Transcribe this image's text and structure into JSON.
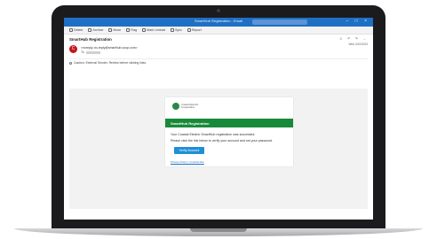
{
  "window": {
    "title": "SmartHub Registration - Email"
  },
  "toolbar": [
    {
      "label": "Delete"
    },
    {
      "label": "Archive"
    },
    {
      "label": "Move"
    },
    {
      "label": "Flag"
    },
    {
      "label": "Mark Unread"
    },
    {
      "label": "Sync"
    },
    {
      "label": "Report"
    }
  ],
  "email": {
    "subject": "SmartHub Registration",
    "avatar_initial": "C",
    "sender": "<noreply-no-reply@smarthub.coop.com>",
    "to_label": "To",
    "date": "Wed 4/10/2024",
    "warning": "Caution: External Sender. Review before clicking links."
  },
  "message": {
    "brand": "Coastal Electric Cooperative",
    "banner": "SmartHub Registration",
    "line1": "Your Coastal Electric SmartHub registration was successful.",
    "line2": "Please click the link below to verify your account and set your password.",
    "button": "Verify Account",
    "footer": "Privacy Policy  |  Unsubscribe"
  },
  "colors": {
    "titlebar": "#1f6fc5",
    "banner": "#178a3a",
    "button": "#1f8fd6",
    "avatar": "#c4161c"
  }
}
